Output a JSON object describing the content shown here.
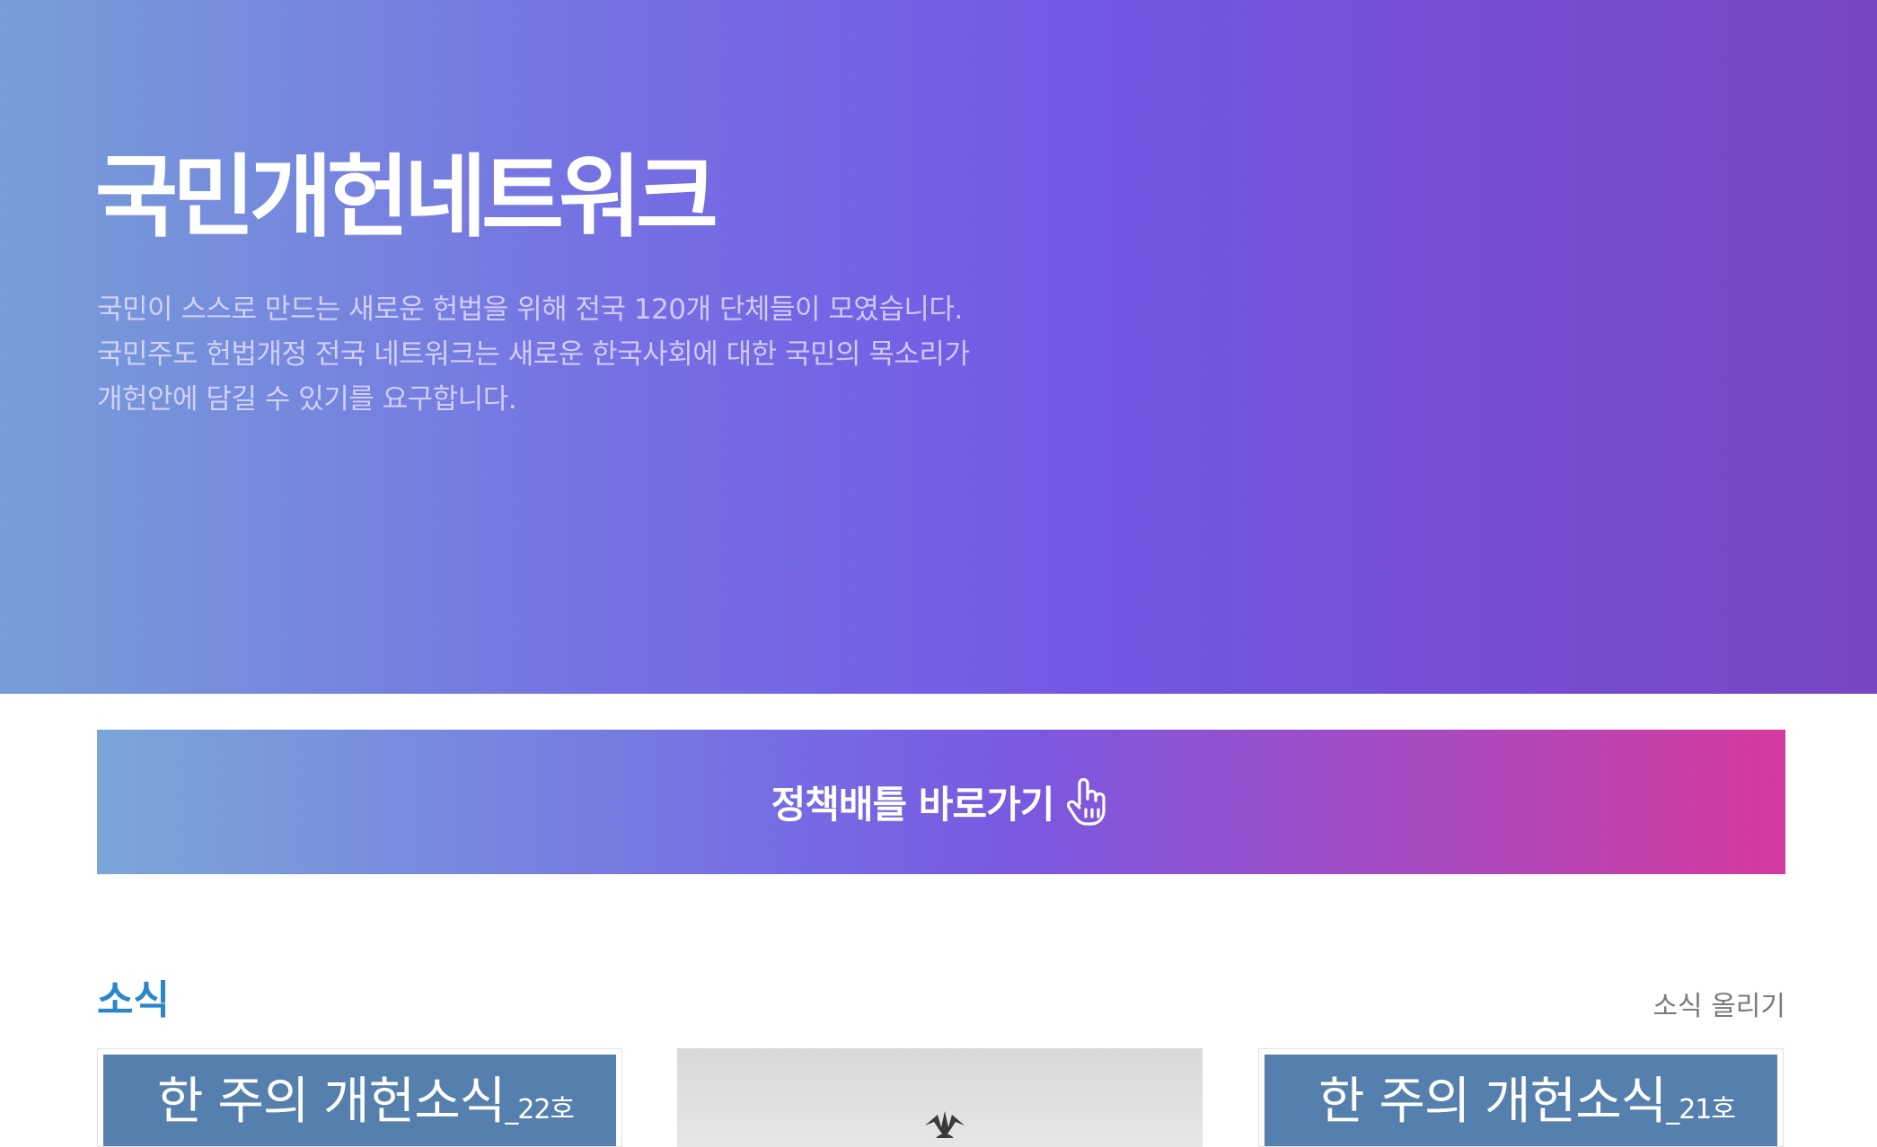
{
  "hero": {
    "title": "국민개헌네트워크",
    "description_lines": [
      "국민이 스스로 만드는 새로운 헌법을 위해 전국 120개 단체들이 모였습니다.",
      "국민주도 헌법개정 전국 네트워크는 새로운 한국사회에 대한 국민의 목소리가",
      "개헌안에 담길 수 있기를 요구합니다."
    ]
  },
  "banner": {
    "label": "정책배틀 바로가기",
    "icon": "pointing-hand-icon"
  },
  "news": {
    "title": "소식",
    "post_link": "소식 올리기",
    "cards": [
      {
        "thumb_text": "한 주의 개헌소식",
        "thumb_sub": "_22호"
      },
      {
        "thumb_text": "",
        "thumb_sub": "",
        "icon": "bird-icon"
      },
      {
        "thumb_text": "한 주의 개헌소식",
        "thumb_sub": "_21호"
      }
    ]
  },
  "colors": {
    "hero_gradient": [
      "#779ed8",
      "#7570e3",
      "#7457e4",
      "#7746c2"
    ],
    "banner_gradient": [
      "#7ba6d8",
      "#756de4",
      "#7a58e0",
      "#d6399d"
    ],
    "section_title": "#2a86c8",
    "card_thumb": "#5580ad"
  }
}
